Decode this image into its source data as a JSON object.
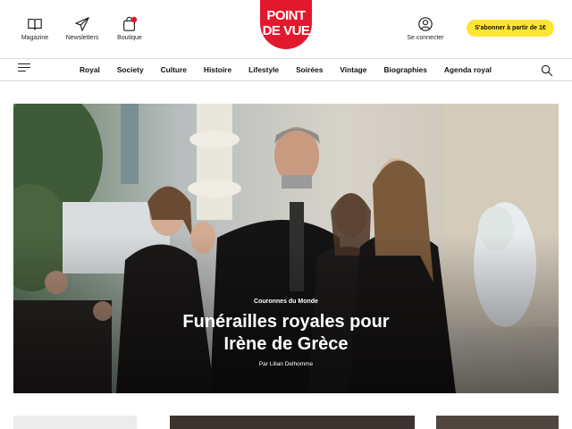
{
  "header": {
    "tools": [
      {
        "label": "Magazine",
        "icon": "book-icon"
      },
      {
        "label": "Newsletters",
        "icon": "paper-plane-icon"
      },
      {
        "label": "Boutique",
        "icon": "shopping-bag-icon"
      }
    ],
    "logo": {
      "line1": "POINT",
      "line2": "DE VUE",
      "color": "#e3182d"
    },
    "account_label": "Se connecter",
    "subscribe_label": "S'abonner à partir de 1€",
    "subscribe_color": "#ffe533"
  },
  "nav": {
    "items": [
      "Royal",
      "Society",
      "Culture",
      "Histoire",
      "Lifestyle",
      "Soirées",
      "Vintage",
      "Biographies",
      "Agenda royal"
    ]
  },
  "hero": {
    "kicker": "Couronnes du Monde",
    "title_line1": "Funérailles royales pour",
    "title_line2": "Irène de Grèce",
    "author": "Par Lilian Delhomme"
  }
}
